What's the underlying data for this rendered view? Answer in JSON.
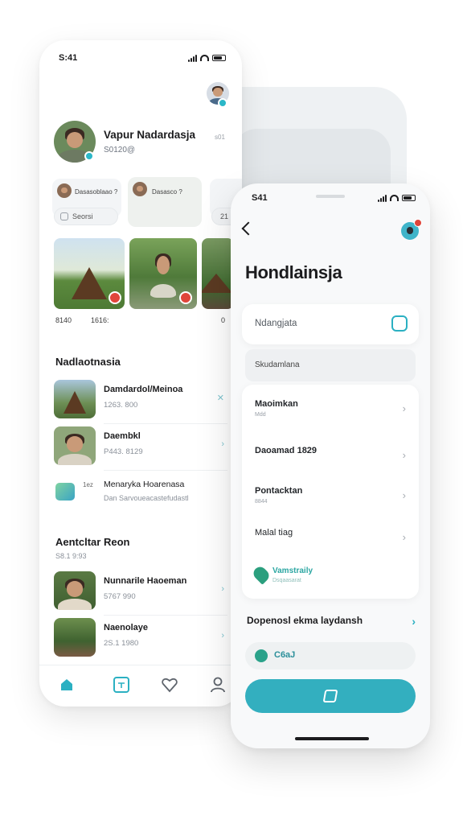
{
  "colors": {
    "accent": "#33afbf",
    "alert": "#e0453a"
  },
  "phone1": {
    "status_time": "S:41",
    "profile": {
      "name": "Vapur Nadardasja",
      "sub": "S0120@",
      "extra": "s01"
    },
    "chips": [
      {
        "label": "Dasasoblaao ?"
      },
      {
        "label": "Dasasco ?"
      }
    ],
    "pills": [
      {
        "label": "Seorsi"
      },
      {
        "label": "21"
      }
    ],
    "photo_meta": [
      "8140",
      "1616:",
      "0"
    ],
    "section1": {
      "title": "Nadlaotnasia",
      "rows": [
        {
          "title": "Damdardol/Meinoa",
          "sub": "1263. 800",
          "icon": "close-icon"
        },
        {
          "title": "Daembkl",
          "sub": "P443. 8129",
          "icon": "chevron-right-icon"
        },
        {
          "title": "Menaryka Hoarenasa",
          "sub": "Dan Sarvoueacastefudastl",
          "prefix": "1ez",
          "icon": ""
        }
      ]
    },
    "section2": {
      "title": "Aentcltar Reon",
      "subtitle": "S8.1 9:93",
      "rows": [
        {
          "title": "Nunnarile Haoeman",
          "sub": "5767 990"
        },
        {
          "title": "Naenolaye",
          "sub": "2S.1 1980"
        }
      ]
    },
    "tabs": [
      "home-icon",
      "calendar-icon",
      "heart-icon",
      "user-icon"
    ]
  },
  "phone2": {
    "status_time": "S41",
    "title": "Hondlainsja",
    "input_label": "Ndangjata",
    "segment": "Skudamlana",
    "items": [
      {
        "title": "Maoimkan",
        "sub": "Mdd"
      },
      {
        "title": "Daoamad 1829",
        "sub": ""
      },
      {
        "title": "Pontacktan",
        "sub": "8844"
      },
      {
        "title": "Malal tiag",
        "sub": ""
      }
    ],
    "vm": {
      "title": "Vamstraily",
      "sub": "Dsqaasarat"
    },
    "section_title": "Dopenosl ekma laydansh",
    "code": "C6aJ",
    "cta_icon": "map-icon"
  }
}
